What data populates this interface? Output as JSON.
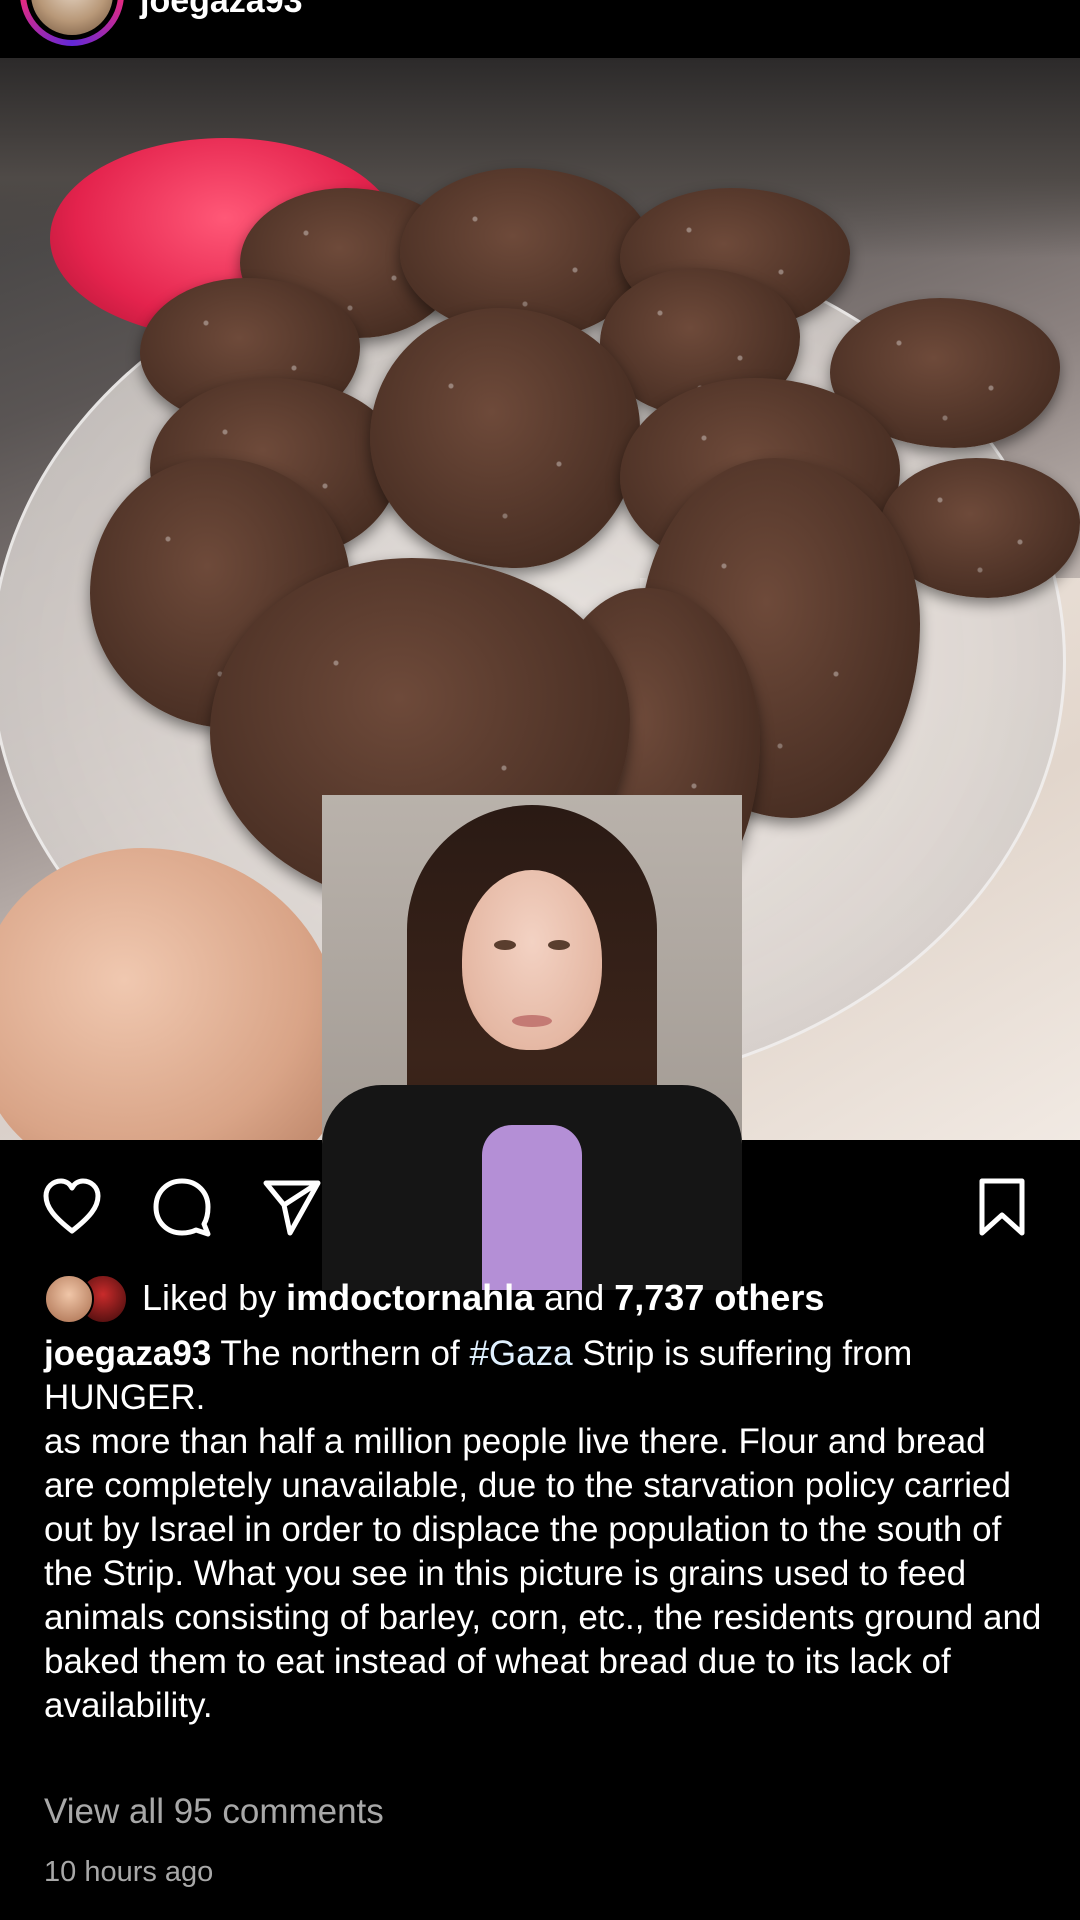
{
  "header": {
    "username": "joegaza93"
  },
  "actions": {
    "like_icon": "heart-outline-icon",
    "comment_icon": "comment-bubble-icon",
    "share_icon": "paper-plane-icon",
    "save_icon": "bookmark-icon"
  },
  "likes": {
    "prefix": "Liked by",
    "liked_by_user": "imdoctornahla",
    "connector": "and",
    "others_count": "7,737 others"
  },
  "caption": {
    "username": "joegaza93",
    "text_before_hashtag": "The northern of",
    "hashtag": "#Gaza",
    "text_after_hashtag": "Strip is suffering from HUNGER.",
    "body": "as more than half a million people live there. Flour and bread are completely unavailable, due to the starvation policy carried out by Israel in order to displace the population to the south of the Strip. What you see in this picture is grains used to feed animals consisting of barley, corn, etc., the residents ground and baked them to eat instead of wheat bread due to its lack of availability."
  },
  "comments": {
    "view_all_label": "View all 95 comments"
  },
  "timestamp": "10 hours ago"
}
